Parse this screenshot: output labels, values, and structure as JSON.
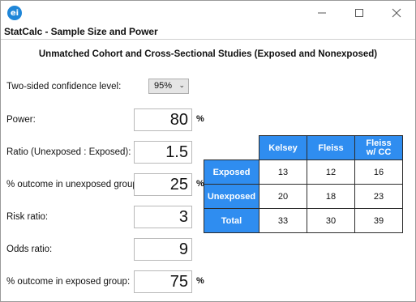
{
  "window": {
    "app_icon": "ei",
    "app_title": "StatCalc - Sample Size and Power"
  },
  "heading": "Unmatched Cohort and Cross-Sectional Studies (Exposed and Nonexposed)",
  "confidence": {
    "label": "Two-sided confidence level:",
    "value": "95%"
  },
  "fields": {
    "power": {
      "label": "Power:",
      "value": "80",
      "unit": "%"
    },
    "ratio": {
      "label": "Ratio (Unexposed : Exposed):",
      "value": "1.5"
    },
    "unexposed_outcome": {
      "label": "% outcome in unexposed group:",
      "value": "25",
      "unit": "%"
    },
    "risk_ratio": {
      "label": "Risk ratio:",
      "value": "3"
    },
    "odds_ratio": {
      "label": "Odds ratio:",
      "value": "9"
    },
    "exposed_outcome": {
      "label": "% outcome in exposed group:",
      "value": "75",
      "unit": "%"
    }
  },
  "results": {
    "columns": [
      "Kelsey",
      "Fleiss",
      "Fleiss\nw/ CC"
    ],
    "rows": [
      {
        "label": "Exposed",
        "values": [
          "13",
          "12",
          "16"
        ]
      },
      {
        "label": "Unexposed",
        "values": [
          "20",
          "18",
          "23"
        ]
      },
      {
        "label": "Total",
        "values": [
          "33",
          "30",
          "39"
        ]
      }
    ]
  },
  "colors": {
    "header_blue": "#2f8df0",
    "icon_blue": "#1f86d8"
  },
  "icons": [
    "app-logo-icon",
    "minimize-icon",
    "maximize-icon",
    "close-icon",
    "chevron-down-icon"
  ]
}
